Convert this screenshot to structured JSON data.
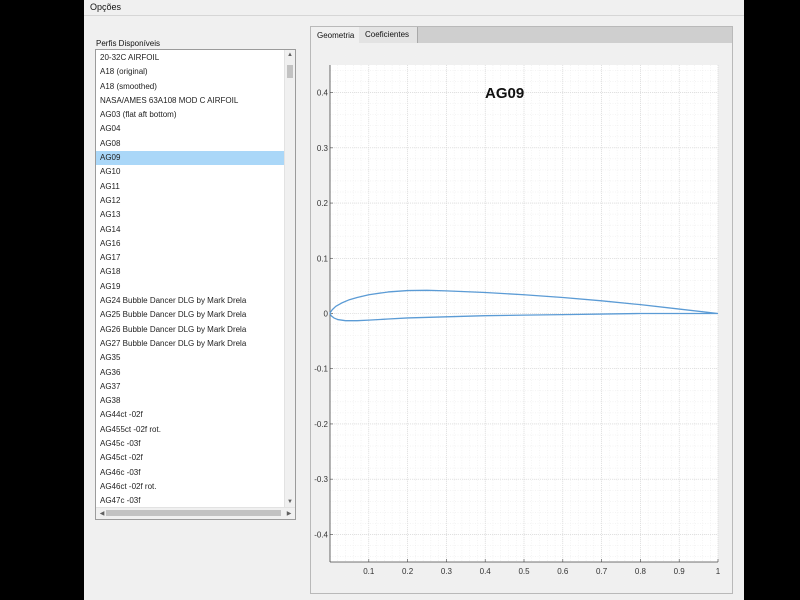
{
  "menu": {
    "options_label": "Opções"
  },
  "list": {
    "title": "Perfis Disponíveis",
    "selected_index": 7,
    "items": [
      "20-32C AIRFOIL",
      "A18 (original)",
      "A18 (smoothed)",
      "NASA/AMES 63A108 MOD C AIRFOIL",
      "AG03 (flat aft bottom)",
      "AG04",
      "AG08",
      "AG09",
      "AG10",
      "AG11",
      "AG12",
      "AG13",
      "AG14",
      "AG16",
      "AG17",
      "AG18",
      "AG19",
      "AG24 Bubble Dancer DLG by Mark Drela",
      "AG25 Bubble Dancer DLG by Mark Drela",
      "AG26 Bubble Dancer DLG by Mark Drela",
      "AG27 Bubble Dancer DLG by Mark Drela",
      "AG35",
      "AG36",
      "AG37",
      "AG38",
      "AG44ct -02f",
      "AG455ct -02f rot.",
      "AG45c -03f",
      "AG45ct -02f",
      "AG46c -03f",
      "AG46ct -02f rot.",
      "AG47c -03f"
    ]
  },
  "tabs": [
    {
      "label": "Geometria",
      "active": true
    },
    {
      "label": "Coeficientes",
      "active": false
    }
  ],
  "chart_data": {
    "type": "line",
    "title": "AG09",
    "xlabel": "",
    "ylabel": "",
    "xlim": [
      0,
      1
    ],
    "ylim": [
      -0.45,
      0.45
    ],
    "xticks": [
      0.1,
      0.2,
      0.3,
      0.4,
      0.5,
      0.6,
      0.7,
      0.8,
      0.9,
      1
    ],
    "xtick_labels": [
      "0.1",
      "0.2",
      "0.3",
      "0.4",
      "0.5",
      "0.6",
      "0.7",
      "0.8",
      "0.9",
      "1"
    ],
    "yticks": [
      0.4,
      0.3,
      0.2,
      0.1,
      0,
      -0.1,
      -0.2,
      -0.3,
      -0.4
    ],
    "ytick_labels": [
      "0.4",
      "0.3",
      "0.2",
      "0.1",
      "0",
      "-0.1",
      "-0.2",
      "-0.3",
      "-0.4"
    ],
    "grid": true,
    "series": [
      {
        "color": "#5b9bd5",
        "x": [
          1,
          0.9,
          0.8,
          0.7,
          0.6,
          0.5,
          0.4,
          0.3,
          0.25,
          0.2,
          0.15,
          0.1,
          0.07,
          0.05,
          0.03,
          0.015,
          0.006,
          0.001,
          0,
          0.003,
          0.01,
          0.02,
          0.04,
          0.07,
          0.1,
          0.15,
          0.2,
          0.3,
          0.4,
          0.5,
          0.6,
          0.7,
          0.8,
          0.9,
          1
        ],
        "y": [
          0,
          0.008,
          0.016,
          0.023,
          0.029,
          0.034,
          0.038,
          0.041,
          0.042,
          0.0415,
          0.039,
          0.034,
          0.029,
          0.025,
          0.019,
          0.013,
          0.007,
          0.002,
          0,
          -0.004,
          -0.008,
          -0.011,
          -0.013,
          -0.013,
          -0.012,
          -0.01,
          -0.008,
          -0.006,
          -0.004,
          -0.003,
          -0.002,
          -0.001,
          0,
          0,
          0
        ]
      }
    ]
  }
}
